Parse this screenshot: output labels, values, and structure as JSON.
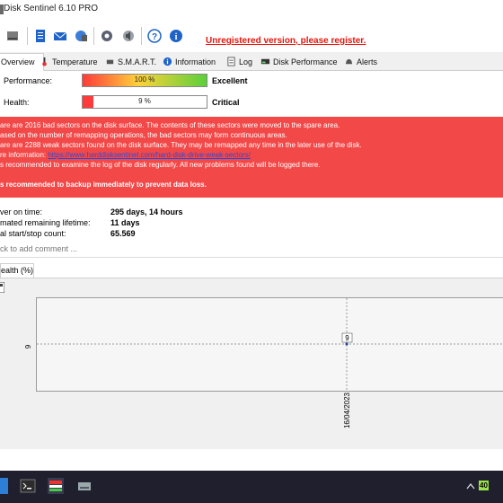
{
  "window": {
    "title": "Disk Sentinel 6.10 PRO"
  },
  "toolbar": {
    "unregistered_text": "Unregistered version, please register.",
    "icons": [
      "drive-icon",
      "document-icon",
      "mail-icon",
      "network-icon",
      "gear-icon",
      "speaker-icon",
      "help-icon",
      "info-icon"
    ]
  },
  "tabs": [
    {
      "label": "Overview",
      "active": true
    },
    {
      "label": "Temperature"
    },
    {
      "label": "S.M.A.R.T."
    },
    {
      "label": "Information"
    },
    {
      "label": "Log"
    },
    {
      "label": "Disk Performance"
    },
    {
      "label": "Alerts"
    }
  ],
  "performance": {
    "label": "Performance:",
    "value_text": "100 %",
    "fraction": 1.0,
    "status": "Excellent"
  },
  "health": {
    "label": "Health:",
    "value_text": "9 %",
    "fraction": 0.09,
    "status": "Critical"
  },
  "alert": {
    "lines": [
      "are are 2016 bad sectors on the disk surface. The contents of these sectors were moved to the spare area.",
      "ased on the number of remapping operations, the bad sectors may form continuous areas.",
      "are are 2288 weak sectors found on the disk surface. They may be remapped any time in the later use of the disk.",
      "re information: ",
      "s recommended to examine the log of the disk regularly. All new problems found will be logged there."
    ],
    "link_text": "https://www.harddisksentinel.com/hard-disk-drive-weak-sectors/",
    "warning": "s recommended to backup immediately to prevent data loss."
  },
  "stats": [
    {
      "label": "ver on time:",
      "value": "295 days, 14 hours"
    },
    {
      "label": "mated remaining lifetime:",
      "value": "11 days"
    },
    {
      "label": "al start/stop count:",
      "value": "65.569"
    }
  ],
  "comment": {
    "placeholder": "ck to add comment ..."
  },
  "chart_tab": {
    "label": "ealth (%)"
  },
  "chart_data": {
    "type": "line",
    "series": [
      {
        "values": [
          9
        ]
      }
    ],
    "x": [
      "16/04/2023"
    ],
    "data_labels": [
      "9"
    ],
    "y_tick_labels": [
      "9"
    ],
    "grid": true
  },
  "taskbar": {
    "battery_text": "40"
  }
}
